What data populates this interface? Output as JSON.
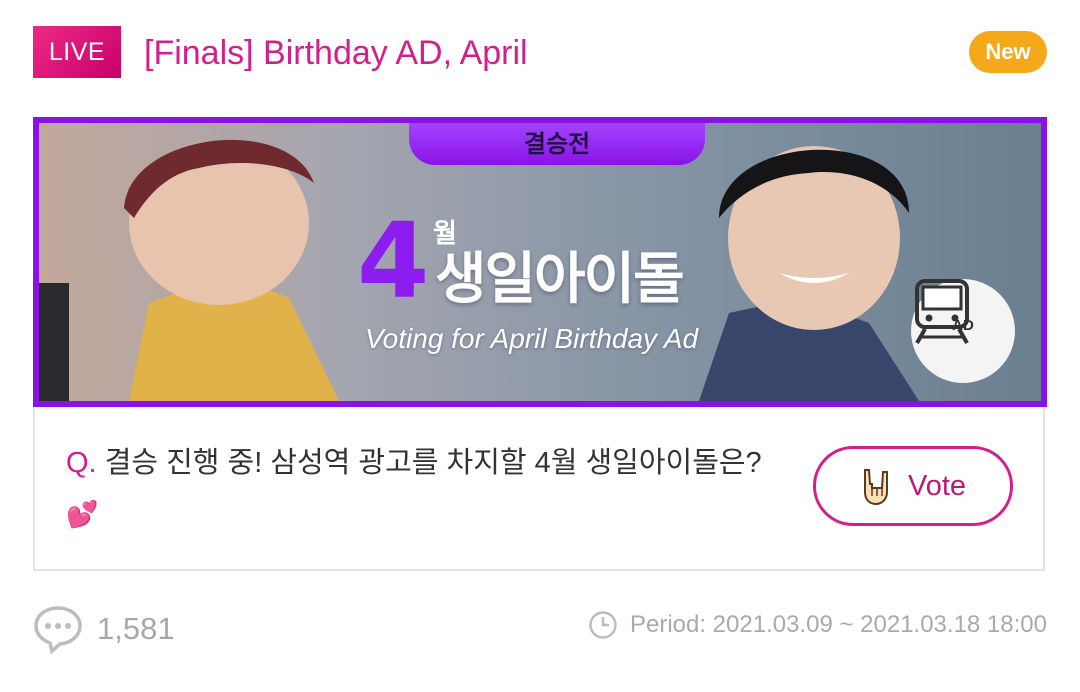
{
  "header": {
    "live_label": "LIVE",
    "title": "[Finals] Birthday AD, April",
    "new_label": "New"
  },
  "banner": {
    "tag": "결승전",
    "big_number": "4",
    "month_label": "월",
    "title": "생일아이돌",
    "subtitle": "Voting for April Birthday Ad",
    "ad_label": "AD"
  },
  "question": {
    "prefix": "Q.",
    "text": "결승 진행 중! 삼성역 광고를 차지할 4월 생일아이돌은?",
    "emoji": "💕"
  },
  "vote": {
    "label": "Vote",
    "icon": "rock-hand-icon"
  },
  "footer": {
    "comment_count": "1,581",
    "comment_icon": "comment-bubble-icon",
    "period_label": "Period: 2021.03.09 ~ 2021.03.18 18:00",
    "clock_icon": "clock-icon"
  },
  "colors": {
    "brand_pink": "#d31f8c",
    "banner_purple": "#8a12e8",
    "new_orange": "#f4a81a",
    "muted_gray": "#aaaaaa"
  }
}
